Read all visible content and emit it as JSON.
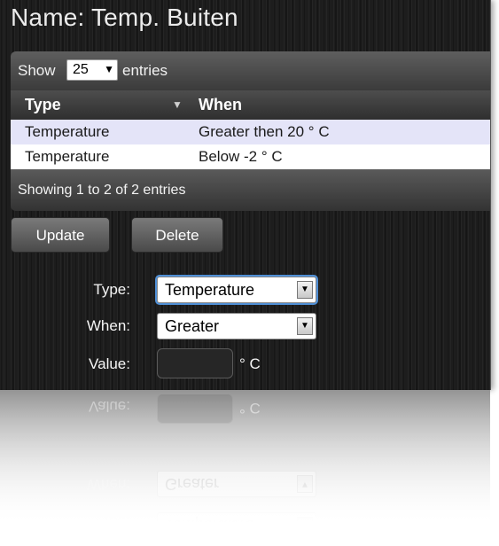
{
  "header": {
    "title": "Name: Temp. Buiten"
  },
  "table": {
    "show_label": "Show",
    "entries_label": "entries",
    "page_size": "25",
    "columns": [
      "Type",
      "When"
    ],
    "rows": [
      [
        "Temperature",
        "Greater then 20 ° C"
      ],
      [
        "Temperature",
        "Below -2 ° C"
      ]
    ],
    "info": "Showing 1 to 2 of 2 entries"
  },
  "buttons": {
    "update": "Update",
    "delete": "Delete"
  },
  "form": {
    "type_label": "Type:",
    "type_value": "Temperature",
    "when_label": "When:",
    "when_value": "Greater",
    "value_label": "Value:",
    "value": "",
    "unit": "° C"
  },
  "colors": {
    "selected_row": "#e4e4f8",
    "focus": "#4f8fd6"
  }
}
